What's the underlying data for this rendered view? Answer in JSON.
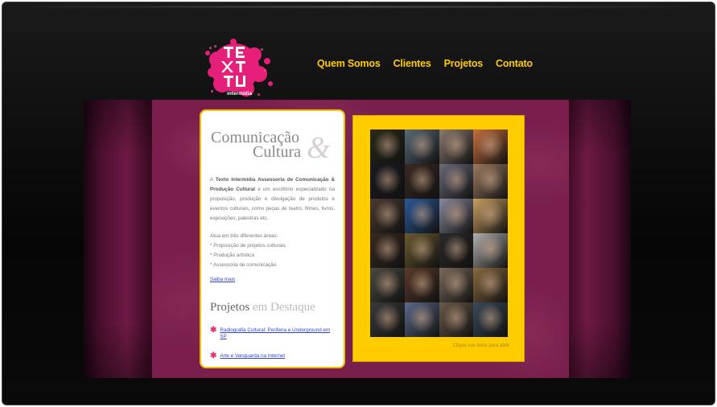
{
  "nav": {
    "items": [
      "Quem Somos",
      "Clientes",
      "Projetos",
      "Contato"
    ]
  },
  "logo": {
    "text": "TEXTO",
    "sub": "intermídia"
  },
  "intro": {
    "title_line1": "Comunicação",
    "title_line2": "Cultura",
    "title_amp": "&",
    "para_prefix": "A ",
    "para_bold": "Texto Intermídia Assessoria de Comunicação & Produção Cultural",
    "para_rest": " é um escritório especializado na proposição, produção e divulgação de produtos e eventos culturais, como peças de teatro, filmes, livros, exposições, palestras etc.",
    "areas_intro": "Atua em três diferentes áreas:",
    "areas": [
      "* Proposição de projetos culturais",
      "* Produção artística",
      "* Assessoria de comunicação"
    ],
    "more_link": "Saiba mais"
  },
  "projects": {
    "title_dark": "Projetos",
    "title_light": "em Destaque",
    "items": [
      "Radiografia Cultural: Periferia e Underground em SP",
      "Arte e Vanguarda na Internet"
    ]
  },
  "photos": {
    "caption": "Clique nas fotos para abrir",
    "tiles": [
      "#2a2a1a",
      "#5a6a7a",
      "#8a7a70",
      "#c87040",
      "#1a1a22",
      "#3a2a22",
      "#6a6a7a",
      "#9a7a60",
      "#4a3a30",
      "#2a5a9a",
      "#8a8a9a",
      "#caa060",
      "#3a2a20",
      "#6a5a30",
      "#2a2a2a",
      "#b0b0b0",
      "#4a4a40",
      "#5a3a2a",
      "#7a6a5a",
      "#8a6a40",
      "#3a3a3a",
      "#5a6a8a",
      "#6a5a4a",
      "#3a4a5a"
    ]
  },
  "colors": {
    "accent": "#ffcc00",
    "magenta": "#7a1f4c",
    "link": "#3344cc",
    "bullet": "#e0306a"
  }
}
